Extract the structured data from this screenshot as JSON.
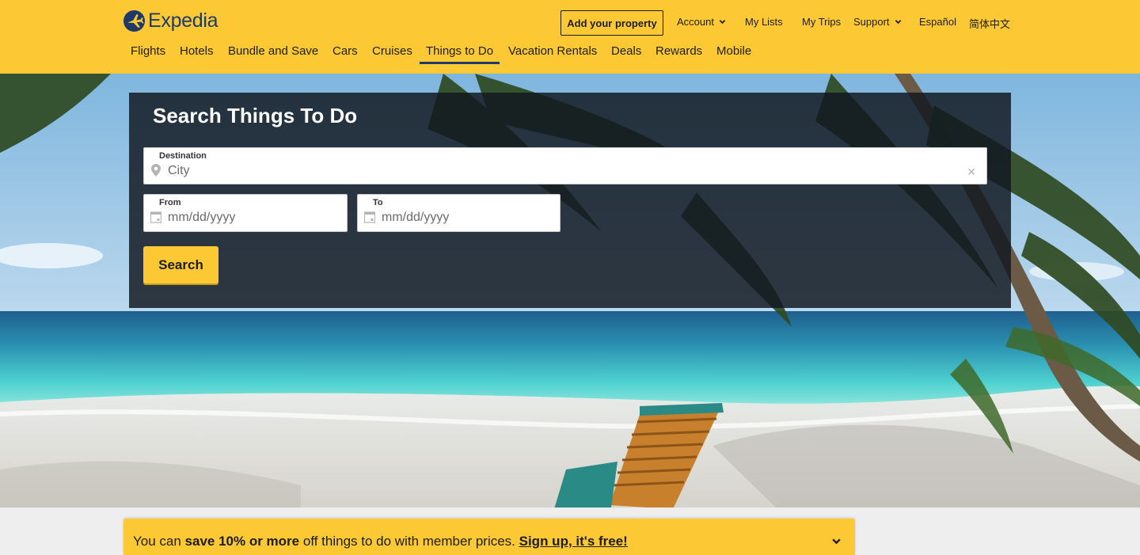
{
  "brand": {
    "name": "Expedia",
    "accent": "#fcc934",
    "navy": "#1d3a6b"
  },
  "header": {
    "add_property": "Add your property",
    "top_links": [
      {
        "label": "Account",
        "has_dropdown": true
      },
      {
        "label": "My Lists",
        "has_dropdown": false
      },
      {
        "label": "My Trips",
        "has_dropdown": false
      },
      {
        "label": "Support",
        "has_dropdown": true
      },
      {
        "label": "Español",
        "has_dropdown": false
      },
      {
        "label": "简体中文",
        "has_dropdown": false
      }
    ],
    "nav": [
      {
        "label": "Flights",
        "active": false
      },
      {
        "label": "Hotels",
        "active": false
      },
      {
        "label": "Bundle and Save",
        "active": false
      },
      {
        "label": "Cars",
        "active": false
      },
      {
        "label": "Cruises",
        "active": false
      },
      {
        "label": "Things to Do",
        "active": true
      },
      {
        "label": "Vacation Rentals",
        "active": false
      },
      {
        "label": "Deals",
        "active": false
      },
      {
        "label": "Rewards",
        "active": false
      },
      {
        "label": "Mobile",
        "active": false
      }
    ]
  },
  "search": {
    "title": "Search Things To Do",
    "destination": {
      "label": "Destination",
      "placeholder": "City",
      "value": "",
      "icon": "map-pin-icon"
    },
    "from": {
      "label": "From",
      "placeholder": "mm/dd/yyyy",
      "value": "",
      "icon": "calendar-icon"
    },
    "to": {
      "label": "To",
      "placeholder": "mm/dd/yyyy",
      "value": "",
      "icon": "calendar-icon"
    },
    "button": "Search"
  },
  "banner": {
    "prefix": "You can ",
    "bold": "save 10% or more",
    "suffix": " off things to do with member prices. ",
    "link": "Sign up, it's free!"
  }
}
